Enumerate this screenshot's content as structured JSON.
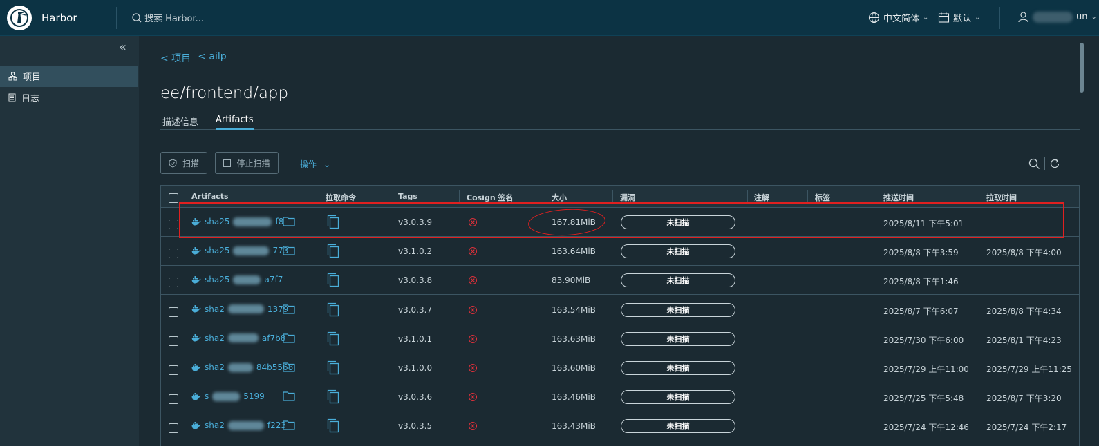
{
  "header": {
    "brand": "Harbor",
    "search_placeholder": "搜索 Harbor...",
    "language": "中文简体",
    "scheme": "默认",
    "user": "un"
  },
  "sidebar": {
    "items": [
      {
        "label": "项目",
        "icon": "project-icon",
        "active": true
      },
      {
        "label": "日志",
        "icon": "log-icon",
        "active": false
      }
    ]
  },
  "breadcrumb": [
    "< 项目",
    "< ailp"
  ],
  "page_title": "ee/frontend/app",
  "tabs": [
    {
      "label": "描述信息",
      "active": false
    },
    {
      "label": "Artifacts",
      "active": true
    }
  ],
  "toolbar": {
    "scan_label": "扫描",
    "stop_scan_label": "停止扫描",
    "actions_label": "操作"
  },
  "table": {
    "columns": [
      "Artifacts",
      "拉取命令",
      "Tags",
      "Cosign 签名",
      "大小",
      "漏洞",
      "注解",
      "标签",
      "推送时间",
      "拉取时间"
    ],
    "rows": [
      {
        "digest_prefix": "sha25",
        "digest_suffix": "f8",
        "tag": "v3.0.3.9",
        "size": "167.81MiB",
        "vuln": "未扫描",
        "push_time": "2025/8/11 下午5:01",
        "pull_time": "",
        "has_folder": true
      },
      {
        "digest_prefix": "sha25",
        "digest_suffix": "773",
        "tag": "v3.1.0.2",
        "size": "163.64MiB",
        "vuln": "未扫描",
        "push_time": "2025/8/8 下午3:59",
        "pull_time": "2025/8/8 下午4:00",
        "has_folder": true
      },
      {
        "digest_prefix": "sha25",
        "digest_suffix": "a7f7",
        "tag": "v3.0.3.8",
        "size": "83.90MiB",
        "vuln": "未扫描",
        "push_time": "2025/8/8 下午1:46",
        "pull_time": "",
        "has_folder": false
      },
      {
        "digest_prefix": "sha2",
        "digest_suffix": "1379",
        "tag": "v3.0.3.7",
        "size": "163.54MiB",
        "vuln": "未扫描",
        "push_time": "2025/8/7 下午6:07",
        "pull_time": "2025/8/8 下午4:34",
        "has_folder": true
      },
      {
        "digest_prefix": "sha2",
        "digest_suffix": "af7b8",
        "tag": "v3.1.0.1",
        "size": "163.63MiB",
        "vuln": "未扫描",
        "push_time": "2025/7/30 下午6:00",
        "pull_time": "2025/8/1 下午4:23",
        "has_folder": true
      },
      {
        "digest_prefix": "sha2",
        "digest_suffix": "84b5568",
        "tag": "v3.1.0.0",
        "size": "163.60MiB",
        "vuln": "未扫描",
        "push_time": "2025/7/29 上午11:00",
        "pull_time": "2025/7/29 上午11:25",
        "has_folder": true
      },
      {
        "digest_prefix": "s",
        "digest_suffix": "5199",
        "tag": "v3.0.3.6",
        "size": "163.46MiB",
        "vuln": "未扫描",
        "push_time": "2025/7/25 下午5:48",
        "pull_time": "2025/8/7 下午3:20",
        "has_folder": true
      },
      {
        "digest_prefix": "sha2",
        "digest_suffix": "f223",
        "tag": "v3.0.3.5",
        "size": "163.43MiB",
        "vuln": "未扫描",
        "push_time": "2025/7/24 下午12:46",
        "pull_time": "2025/7/24 下午2:17",
        "has_folder": true
      }
    ]
  },
  "colors": {
    "header_bg": "#0c3344",
    "sidebar_bg": "#21333c",
    "content_bg": "#1b2a32",
    "accent": "#4aaed9",
    "annotation_red": "#e02020"
  }
}
